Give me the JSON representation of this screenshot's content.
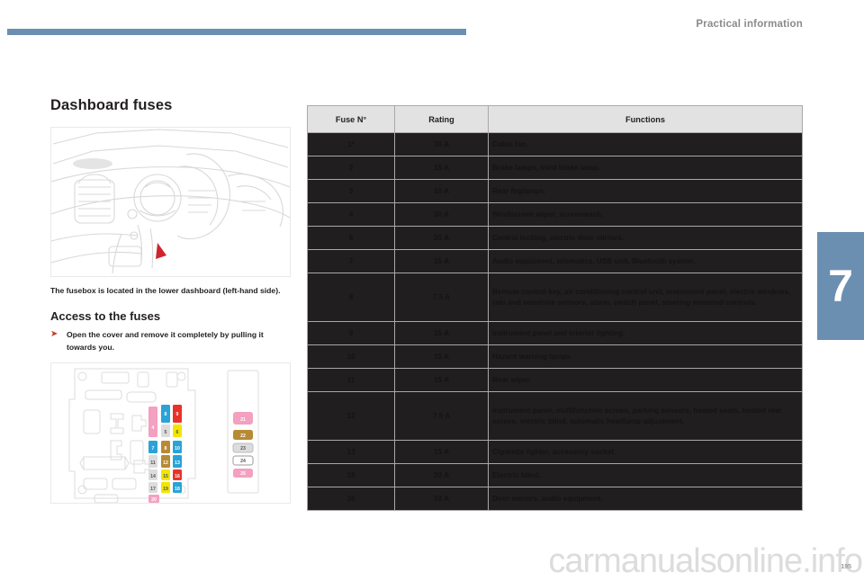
{
  "header": {
    "title": "Practical information",
    "accent_color": "#6b8fb0"
  },
  "chapter": {
    "number": "7"
  },
  "left": {
    "section_title": "Dashboard fuses",
    "dashboard_illustration_alt": "dashboard-line-drawing",
    "intro_text": "The fusebox is located in the lower dashboard (left-hand side).",
    "access_title": "Access to the fuses",
    "bullet": "Open the cover and remove it completely by pulling it towards you.",
    "fusebox_illustration_alt": "fusebox-layout-diagram"
  },
  "fusebox_diagram": {
    "fuses": [
      {
        "n": "1",
        "color": "#f4a0c0"
      },
      {
        "n": "4",
        "color": "#f4a0c0"
      },
      {
        "n": "8",
        "color": "#29a3d8"
      },
      {
        "n": "9",
        "color": "#e8332a"
      },
      {
        "n": "5",
        "color": "#dcdcdc"
      },
      {
        "n": "6",
        "color": "#f2e600"
      },
      {
        "n": "7",
        "color": "#29a3d8"
      },
      {
        "n": "8b",
        "color": "#b78a34"
      },
      {
        "n": "10",
        "color": "#29a3d8"
      },
      {
        "n": "11",
        "color": "#dcdcdc"
      },
      {
        "n": "12",
        "color": "#b78a34"
      },
      {
        "n": "13",
        "color": "#29a3d8"
      },
      {
        "n": "14",
        "color": "#dcdcdc"
      },
      {
        "n": "15",
        "color": "#f2e600"
      },
      {
        "n": "16",
        "color": "#e8332a"
      },
      {
        "n": "17",
        "color": "#dcdcdc"
      },
      {
        "n": "19",
        "color": "#f2e600"
      },
      {
        "n": "18",
        "color": "#29a3d8"
      },
      {
        "n": "20",
        "color": "#f4a0c0"
      },
      {
        "n": "21",
        "color": "#f4a0c0"
      },
      {
        "n": "22",
        "color": "#b78a34"
      },
      {
        "n": "23",
        "color": "#dcdcdc"
      },
      {
        "n": "24",
        "color": "#ffffff"
      },
      {
        "n": "25",
        "color": "#f4a0c0"
      }
    ]
  },
  "table": {
    "headers": {
      "fuse_no": "Fuse N°",
      "rating": "Rating",
      "functions": "Functions"
    },
    "rows": [
      {
        "no": "1*",
        "rating": "30 A",
        "functions": "Cabin fan."
      },
      {
        "no": "2",
        "rating": "15 A",
        "functions": "Brake lamps, third brake lamp."
      },
      {
        "no": "3",
        "rating": "10 A",
        "functions": "Rear foglamps."
      },
      {
        "no": "4",
        "rating": "30 A",
        "functions": "Windscreen wiper, screenwash."
      },
      {
        "no": "6",
        "rating": "20 A",
        "functions": "Central locking, electric door mirrors."
      },
      {
        "no": "7",
        "rating": "15 A",
        "functions": "Audio equipment, telematics, USB unit, Bluetooth system."
      },
      {
        "no": "8",
        "rating": "7.5 A",
        "functions": "Remote control key, air conditioning control unit, instrument panel, electric windows, rain and sunshine sensors, alarm, switch panel, steering mounted controls."
      },
      {
        "no": "9",
        "rating": "15 A",
        "functions": "Instrument panel and interior lighting."
      },
      {
        "no": "10",
        "rating": "15 A",
        "functions": "Hazard warning lamps"
      },
      {
        "no": "11",
        "rating": "15 A",
        "functions": "Rear wiper."
      },
      {
        "no": "12",
        "rating": "7.5 A",
        "functions": "Instrument panel, multifunction screen, parking sensors, heated seats, heated rear screen, electric blind, automatic headlamp adjustment."
      },
      {
        "no": "13",
        "rating": "15 A",
        "functions": "Cigarette lighter, accessory socket."
      },
      {
        "no": "15",
        "rating": "20 A",
        "functions": "Electric blind."
      },
      {
        "no": "16",
        "rating": "10 A",
        "functions": "Door mirrors, audio equipment."
      }
    ]
  },
  "footer": {
    "watermark": "carmanualsonline.info",
    "page_number": "195"
  }
}
